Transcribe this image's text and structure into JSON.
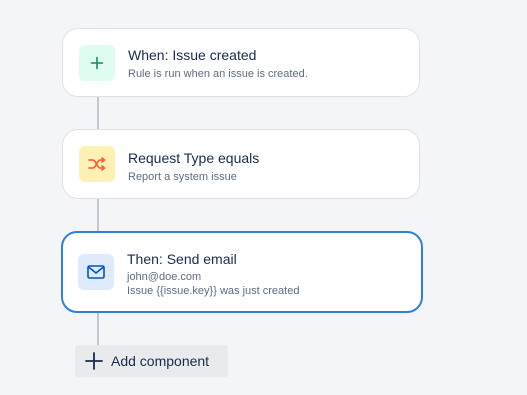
{
  "rule": {
    "trigger": {
      "title": "When: Issue created",
      "description": "Rule is run when an issue is created.",
      "icon": "plus-icon",
      "icon_bg": "#dffcf0",
      "icon_color": "#36b37e"
    },
    "condition": {
      "title": "Request Type equals",
      "description": "Report a system issue",
      "icon": "shuffle-icon",
      "icon_bg": "#fff0b3",
      "icon_color": "#ff5630"
    },
    "action": {
      "title": "Then: Send email",
      "to": "john@doe.com",
      "subject": "Issue {{issue.key}} was just created",
      "icon": "email-icon",
      "icon_bg": "#deebff",
      "icon_color": "#0052cc"
    }
  },
  "add_component": {
    "label": "Add component",
    "icon": "plus-icon"
  },
  "colors": {
    "selected_border": "#2f7fe0",
    "background": "#f4f5f7"
  }
}
